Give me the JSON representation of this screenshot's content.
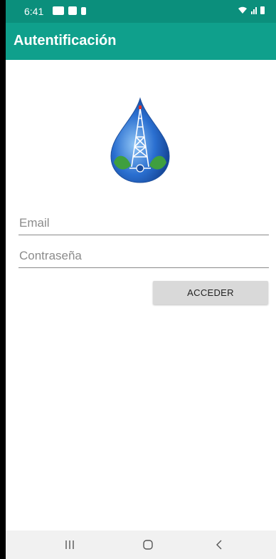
{
  "status_bar": {
    "time": "6:41",
    "icons": [
      "gallery-icon",
      "notification-icon",
      "card-icon",
      "wifi-icon",
      "signal-icon",
      "battery-icon"
    ]
  },
  "app_bar": {
    "title": "Autentificación"
  },
  "logo": {
    "icon": "water-drop-drilling-rig-logo",
    "colors": {
      "drop": "#2a6fd0",
      "leaf": "#3f9f3f",
      "rig": "#ffffff"
    }
  },
  "form": {
    "email": {
      "placeholder": "Email",
      "value": ""
    },
    "password": {
      "placeholder": "Contraseña",
      "value": ""
    },
    "submit_label": "ACCEDER"
  },
  "nav_bar": {
    "icons": [
      "recents-icon",
      "home-icon",
      "back-icon"
    ]
  },
  "colors": {
    "status_bar": "#0b8f7c",
    "app_bar": "#0fa08c",
    "button": "#d9d9d9"
  }
}
